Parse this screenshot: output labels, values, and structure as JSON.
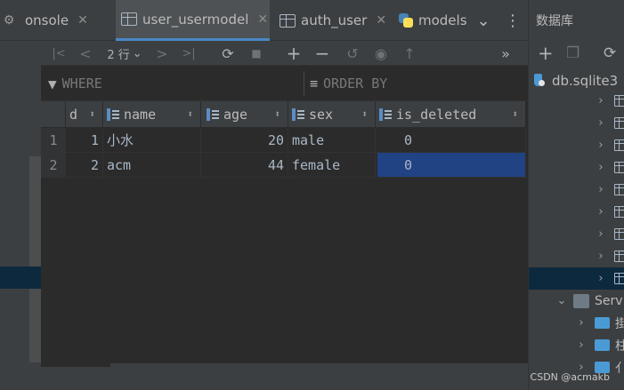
{
  "tabs": [
    {
      "label": "onsole",
      "active": false,
      "icon": "none",
      "closable": true
    },
    {
      "label": "user_usermodel",
      "active": true,
      "icon": "table-icon",
      "closable": true
    },
    {
      "label": "auth_user",
      "active": false,
      "icon": "table-icon",
      "closable": true
    },
    {
      "label": "models",
      "active": false,
      "icon": "python-file-icon",
      "closable": false
    }
  ],
  "tabbar": {
    "close_glyph": "✕",
    "overflow_glyph": "⌄",
    "more_glyph": "⋮"
  },
  "toolbar": {
    "first_glyph": "|<",
    "prev_glyph": "<",
    "rows_label": "2 行",
    "rows_caret": "⌄",
    "next_glyph": ">",
    "last_glyph": ">|",
    "refresh_glyph": "⟳",
    "stop_glyph": "■",
    "add_glyph": "+",
    "remove_glyph": "−",
    "revert_glyph": "↺",
    "preview_glyph": "◉",
    "submit_glyph": "↑",
    "overflow_glyph": "»"
  },
  "filter": {
    "where_label": "WHERE",
    "order_by_label": "ORDER BY"
  },
  "grid": {
    "columns": [
      {
        "label": "d",
        "icon": "none"
      },
      {
        "label": "name",
        "icon": "column-icon"
      },
      {
        "label": "age",
        "icon": "column-icon"
      },
      {
        "label": "sex",
        "icon": "column-icon"
      },
      {
        "label": "is_deleted",
        "icon": "column-icon"
      }
    ],
    "sort_glyph": "⬍",
    "rows": [
      {
        "num": "1",
        "cells": [
          "1",
          "小水",
          "20",
          "male",
          "0"
        ]
      },
      {
        "num": "2",
        "cells": [
          "2",
          "acm",
          "44",
          "female",
          "0"
        ]
      }
    ],
    "selected": {
      "row": 2,
      "column": "is_deleted"
    }
  },
  "database_panel": {
    "title": "数据库",
    "toolbar": {
      "add_glyph": "+",
      "copy_glyph": "❐",
      "refresh_glyph": "⟳"
    },
    "datasource": "db.sqlite3",
    "table_rows": 9,
    "selected_table_index": 9,
    "server_node": "Serv",
    "folder_nodes": [
      "掛",
      "柱",
      "亻"
    ]
  },
  "watermark": "CSDN @acmakb",
  "colors": {
    "accent": "#4a88c7",
    "selection": "#214283",
    "tree_selection": "#0d293e"
  }
}
